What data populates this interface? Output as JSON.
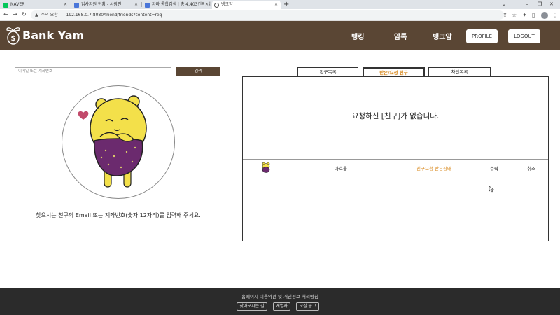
{
  "browser": {
    "tabs": [
      {
        "title": "NAVER",
        "active": false
      },
      {
        "title": "입사지원 현황 - 사람인",
        "active": false
      },
      {
        "title": "자바 통합검색 | 총 4,403건의 검",
        "active": false
      },
      {
        "title": "뱅크얌",
        "active": true
      }
    ],
    "new_tab_label": "+",
    "warning_label": "주의 요함",
    "url": "192.168.0.7:8080/friend/friends?content=req"
  },
  "header": {
    "brand": "Bank Yam",
    "menu": [
      "뱅킹",
      "얌톡",
      "뱅크얌"
    ],
    "profile_button": "PROFILE",
    "logout_button": "LOGOUT"
  },
  "search": {
    "placeholder": "이메일 또는 계좌번호",
    "button_label": "검색",
    "hint": "찾으시는 친구의 Email 또는 계좌번호(숫자 12자리)를 입력해 주세요."
  },
  "friend_tabs": [
    {
      "label": "친구목록",
      "active": false
    },
    {
      "label": "받은/요청 친구",
      "active": true
    },
    {
      "label": "차단목록",
      "active": false
    }
  ],
  "panel": {
    "empty_message": "요청하신 [친구]가 없습니다.",
    "request_row": {
      "name": "아호옴",
      "status": "친구요청 받은상태",
      "accept": "수락",
      "cancel": "취소"
    }
  },
  "footer": {
    "text": "홈페이지 이용약관 및 개인정보 처리방침",
    "buttons": [
      "찾아오시는 길",
      "게열사",
      "모집 공고"
    ]
  },
  "colors": {
    "brand_brown": "#5a4634",
    "accent_orange": "#d98a1f",
    "footer_bg": "#2b2b2b"
  }
}
